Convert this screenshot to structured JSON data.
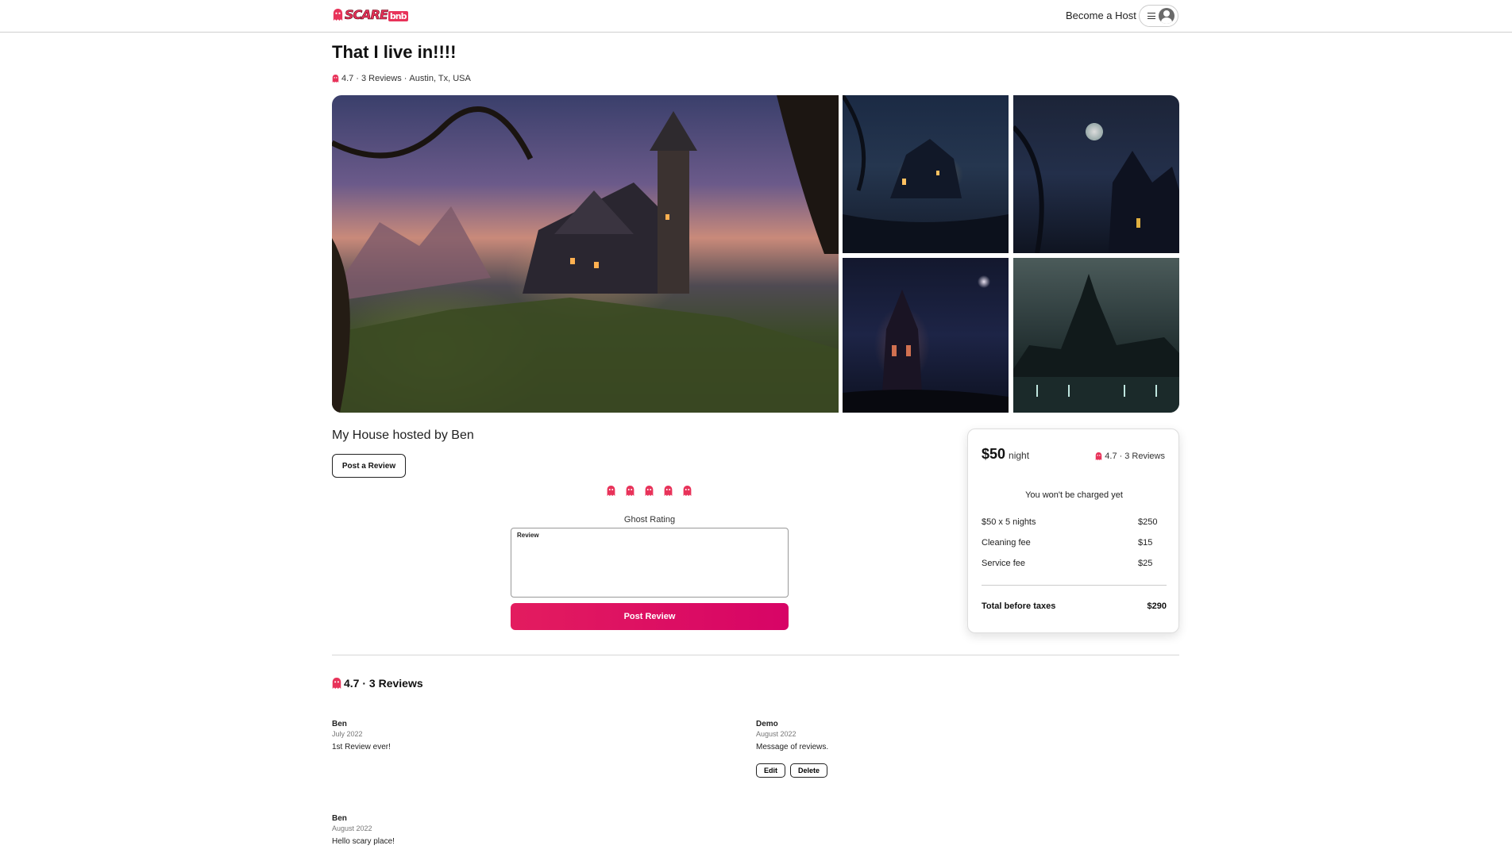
{
  "header": {
    "logo_text": "SCARE",
    "logo_suffix": "bnb",
    "become_host": "Become a Host"
  },
  "listing": {
    "title": "That I live in!!!!",
    "rating": "4.7",
    "reviews_count": "3 Reviews",
    "location": "Austin, Tx, USA",
    "hosted_by": "My House hosted by Ben"
  },
  "review_form": {
    "open_button": "Post a Review",
    "rating_label": "Ghost Rating",
    "review_label": "Review",
    "submit_button": "Post Review"
  },
  "booking": {
    "price": "$50",
    "price_unit": "night",
    "rating": "4.7",
    "reviews_count": "3 Reviews",
    "not_charged": "You won't be charged yet",
    "fees": [
      {
        "label": "$50 x 5 nights",
        "value": "$250"
      },
      {
        "label": "Cleaning fee",
        "value": "$15"
      },
      {
        "label": "Service fee",
        "value": "$25"
      }
    ],
    "total_label": "Total before taxes",
    "total_value": "$290"
  },
  "reviews_section": {
    "heading": "4.7 · 3 Reviews",
    "items": [
      {
        "name": "Ben",
        "date": "July 2022",
        "text": "1st Review ever!"
      },
      {
        "name": "Demo",
        "date": "August 2022",
        "text": "Message of reviews.",
        "edit": "Edit",
        "delete": "Delete"
      },
      {
        "name": "Ben",
        "date": "August 2022",
        "text": "Hello scary place!"
      }
    ]
  },
  "colors": {
    "accent": "#e31c5f",
    "accent_dark": "#d70466",
    "ghost": "#e8335a"
  },
  "icons": [
    "ghost-icon",
    "menu-icon",
    "avatar-icon"
  ]
}
